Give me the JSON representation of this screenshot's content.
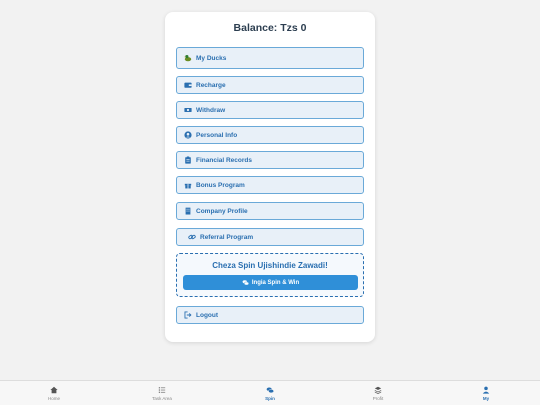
{
  "balance": "Balance: Tzs 0",
  "menu": {
    "my_ducks": "My Ducks",
    "recharge": "Recharge",
    "withdraw": "Withdraw",
    "personal_info": "Personal Info",
    "financial_records": "Financial Records",
    "bonus_program": "Bonus Program",
    "company_profile": "Company Profile",
    "referral_program": "Referral Program",
    "logout": "Logout"
  },
  "spin": {
    "title": "Cheza Spin Ujishindie Zawadi!",
    "button": "Ingia Spin & Win"
  },
  "nav": {
    "home": "Home",
    "task_area": "Task Area",
    "spin": "Spin",
    "profit": "Profit",
    "my": "My",
    "active": "My"
  },
  "colors": {
    "accent": "#2a6fb0",
    "button_bg": "#e8f0f8",
    "spin_button": "#2f8fd8"
  }
}
